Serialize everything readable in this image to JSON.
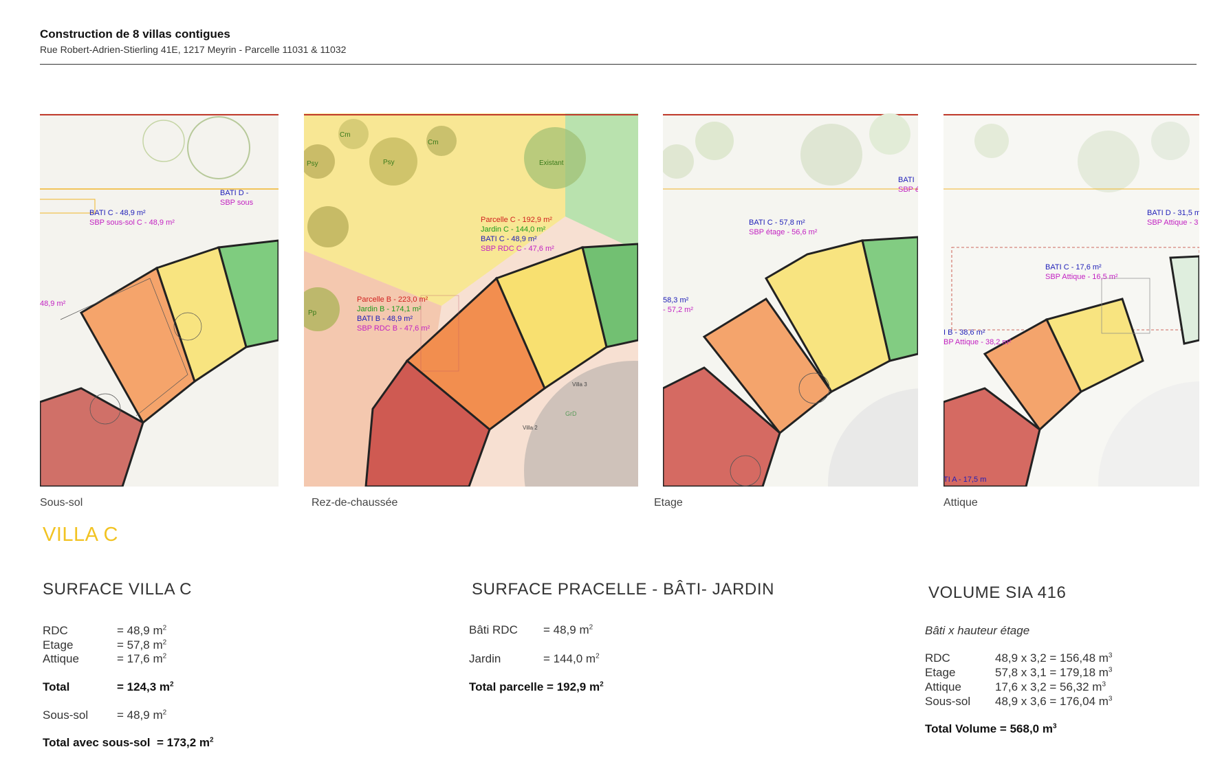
{
  "header": {
    "title": "Construction de 8 villas contigues",
    "subtitle": "Rue Robert-Adrien-Stierling 41E, 1217 Meyrin - Parcelle 11031 & 11032"
  },
  "plans": {
    "sous_sol": {
      "caption": "Sous-sol",
      "labels": [
        "BATI C - 48,9 m²",
        "SBP sous-sol C - 48,9 m²",
        "BATI D -",
        "SBP sous",
        "48,9 m²"
      ]
    },
    "rdc": {
      "caption": "Rez-de-chaussée",
      "labels": [
        "Parcelle C - 192,9 m²",
        "Jardin C - 144,0 m²",
        "BATI C - 48,9 m²",
        "SBP RDC C - 47,6 m²",
        "Parcelle B - 223,0 m²",
        "Jardin B - 174,1 m²",
        "BATI B - 48,9 m²",
        "SBP RDC B - 47,6 m²",
        "Cm",
        "Psy",
        "Existant",
        "Pp",
        "GrD",
        "Villa 3",
        "Villa 2"
      ]
    },
    "etage": {
      "caption": "Etage",
      "labels": [
        "BATI C - 57,8 m²",
        "SBP étage - 56,6 m²",
        "58,3 m²",
        "- 57,2 m²",
        "BATI",
        "SBP é"
      ]
    },
    "attique": {
      "caption": "Attique",
      "labels": [
        "BATI C - 17,6 m²",
        "SBP Attique - 16,5 m²",
        "BATI D - 31,5 m",
        "SBP Attique - 3",
        "I B - 38,6 m²",
        "BP Attique - 38,2 m²",
        "TI A - 17,5 m"
      ]
    }
  },
  "villa_title": "VILLA C",
  "surface_villa": {
    "title": "SURFACE VILLA C",
    "rows": [
      {
        "label": "RDC",
        "value": "= 48,9 m",
        "unit": "2"
      },
      {
        "label": "Etage",
        "value": "= 57,8 m",
        "unit": "2"
      },
      {
        "label": "Attique",
        "value": "= 17,6 m",
        "unit": "2"
      }
    ],
    "total_label": "Total",
    "total_value": "= 124,3 m",
    "sous_sol_label": "Sous-sol",
    "sous_sol_value": "= 48,9 m",
    "total_ss_label": "Total avec sous-sol",
    "total_ss_value": "= 173,2 m",
    "unit": "2"
  },
  "surface_parcelle": {
    "title": "SURFACE PRACELLE - BÂTI- JARDIN",
    "bati_label": "Bâti RDC",
    "bati_value": "= 48,9 m",
    "jardin_label": "Jardin",
    "jardin_value": "= 144,0  m",
    "total": "Total parcelle = 192,9 m",
    "unit": "2"
  },
  "volume": {
    "title": "VOLUME SIA 416",
    "subtitle": "Bâti x hauteur étage",
    "rows": [
      {
        "label": "RDC",
        "value": "48,9 x 3,2 = 156,48 m"
      },
      {
        "label": "Etage",
        "value": "57,8 x 3,1 = 179,18 m"
      },
      {
        "label": "Attique",
        "value": "17,6 x 3,2 = 56,32 m"
      },
      {
        "label": "Sous-sol",
        "value": "48,9 x 3,6 = 176,04 m"
      }
    ],
    "total": "Total Volume = 568,0 m",
    "unit": "3"
  },
  "colors": {
    "villa_title": "#f2c322",
    "zone_red": "#c9594f",
    "zone_orange": "#f29a5a",
    "zone_yellow": "#f7e27a",
    "zone_green": "#6cc36c",
    "bati_blue": "#1d1db8",
    "sbp_magenta": "#c222c2",
    "parcelle_red": "#d0201e",
    "jardin_green": "#1c9a1c"
  }
}
